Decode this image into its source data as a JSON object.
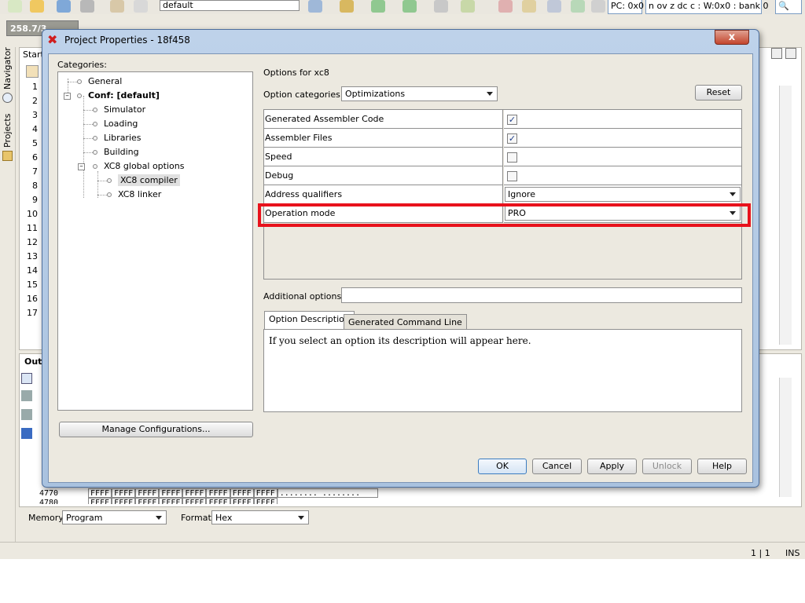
{
  "ide": {
    "toolbar": {
      "config_value": "default",
      "pc_label": "PC: 0x0",
      "status_flags": "n ov z dc c  : W:0x0 : bank 0"
    },
    "memory_gauge": "258.7/3...",
    "side_tabs": {
      "navigator": "Navigator",
      "projects": "Projects"
    },
    "editor_tab": "Start",
    "line_numbers": [
      "1",
      "2",
      "3",
      "4",
      "5",
      "6",
      "7",
      "8",
      "9",
      "10",
      "11",
      "12",
      "13",
      "14",
      "15",
      "16",
      "17"
    ],
    "output_tab": "Out",
    "memory_rows": [
      {
        "addr": "4770",
        "cells": [
          "FFFF",
          "FFFF",
          "FFFF",
          "FFFF",
          "FFFF",
          "FFFF",
          "FFFF",
          "FFFF"
        ],
        "ascii": "........ ........"
      },
      {
        "addr": "4780",
        "cells": [
          "FFFF",
          "FFFF",
          "FFFF",
          "FFFF",
          "FFFF",
          "FFFF",
          "FFFF",
          "FFFF"
        ],
        "ascii": ""
      }
    ],
    "memory_label": "Memory",
    "memory_value": "Program",
    "format_label": "Format",
    "format_value": "Hex",
    "status": {
      "position": "1 | 1",
      "mode": "INS"
    }
  },
  "dialog": {
    "title": "Project Properties - 18f458",
    "close_label": "x",
    "categories_label": "Categories:",
    "tree": {
      "general": "General",
      "conf": "Conf: [default]",
      "simulator": "Simulator",
      "loading": "Loading",
      "libraries": "Libraries",
      "building": "Building",
      "xc8_global": "XC8 global options",
      "xc8_compiler": "XC8 compiler",
      "xc8_linker": "XC8 linker"
    },
    "manage_configurations": "Manage Configurations...",
    "options_for": "Options for xc8",
    "option_categories_label": "Option categories:",
    "option_categories_value": "Optimizations",
    "reset_label": "Reset",
    "options": [
      {
        "name": "Generated Assembler Code",
        "checked": true
      },
      {
        "name": "Assembler Files",
        "checked": true
      },
      {
        "name": "Speed",
        "checked": false
      },
      {
        "name": "Debug",
        "checked": false
      },
      {
        "name": "Address qualifiers",
        "value": "Ignore"
      },
      {
        "name": "Operation mode",
        "value": "PRO"
      }
    ],
    "additional_options_label": "Additional options:",
    "additional_options_value": "",
    "tabs": {
      "description": "Option Description",
      "command_line": "Generated Command Line"
    },
    "description_text": "If you select an option its description will appear here.",
    "buttons": {
      "ok": "OK",
      "cancel": "Cancel",
      "apply": "Apply",
      "unlock": "Unlock",
      "help": "Help"
    },
    "highlight_color": "#e8121c"
  }
}
